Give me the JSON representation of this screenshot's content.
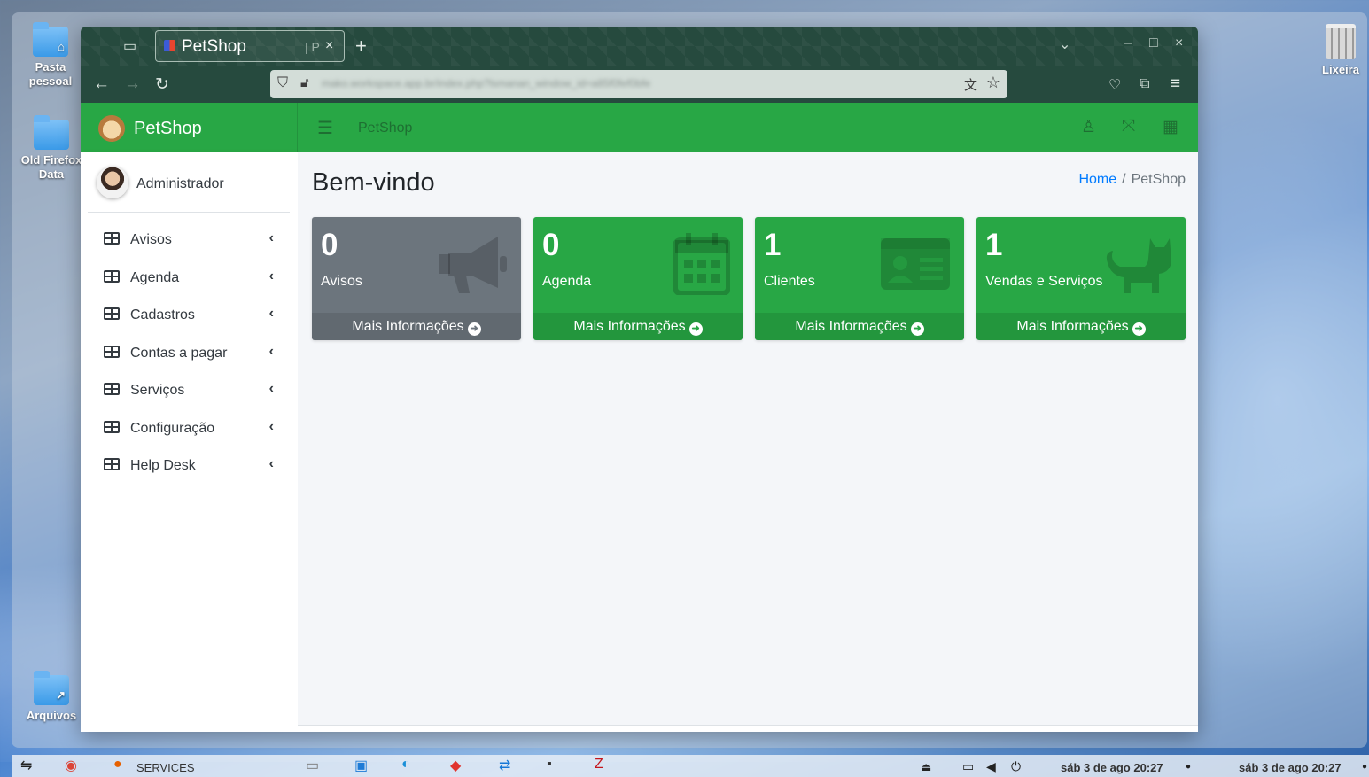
{
  "desktop": {
    "icons": [
      {
        "label_line1": "Pasta",
        "label_line2": "pessoal"
      },
      {
        "label_line1": "Old Firefox",
        "label_line2": "Data"
      },
      {
        "label_line1": "Arquivos"
      },
      {
        "label_line1": "Lixeira"
      }
    ]
  },
  "browser": {
    "tab": {
      "title": "PetShop",
      "suffix": "| P",
      "close": "×"
    },
    "new_tab": "+",
    "url_blurred": "mako.workspace.app.br/index.php?lsmanan_window_id=a85f0fef0bfe",
    "window_controls": [
      "⌄",
      "–",
      "□",
      "×"
    ]
  },
  "app": {
    "brand": "PetShop",
    "topbar_title": "PetShop",
    "user": "Administrador",
    "menu": [
      {
        "label": "Avisos"
      },
      {
        "label": "Agenda"
      },
      {
        "label": "Cadastros"
      },
      {
        "label": "Contas a pagar"
      },
      {
        "label": "Serviços"
      },
      {
        "label": "Configuração"
      },
      {
        "label": "Help Desk"
      }
    ],
    "page_title": "Bem-vindo",
    "breadcrumb": {
      "home": "Home",
      "separator": "/",
      "current": "PetShop"
    },
    "cards": [
      {
        "value": "0",
        "label": "Avisos",
        "footer": "Mais Informações",
        "color": "#6c757d",
        "icon": "bullhorn-icon"
      },
      {
        "value": "0",
        "label": "Agenda",
        "footer": "Mais Informações",
        "color": "#28a745",
        "icon": "calendar-icon"
      },
      {
        "value": "1",
        "label": "Clientes",
        "footer": "Mais Informações",
        "color": "#28a745",
        "icon": "id-card-icon"
      },
      {
        "value": "1",
        "label": "Vendas e Serviços",
        "footer": "Mais Informações",
        "color": "#28a745",
        "icon": "cat-icon"
      }
    ]
  },
  "taskbar": {
    "services_label": "SERVICES",
    "clock1": "sáb 3 de ago  20:27",
    "clock2": "sáb 3 de ago  20:27"
  }
}
